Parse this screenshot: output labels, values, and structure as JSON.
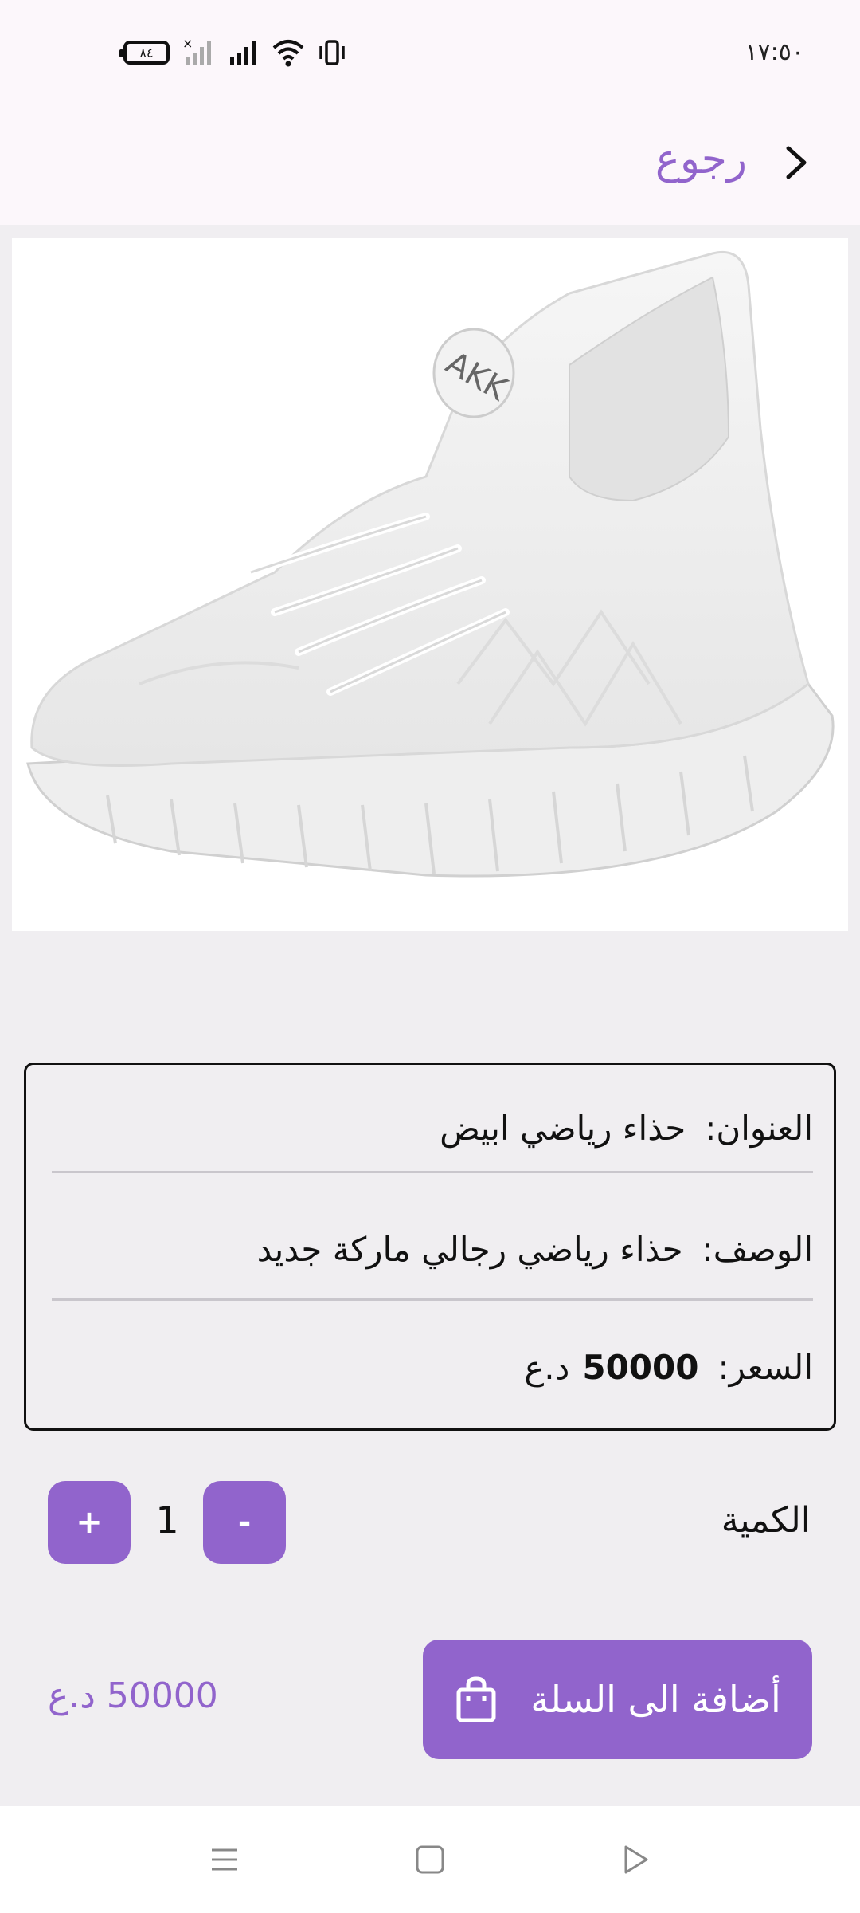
{
  "status_bar": {
    "time": "١٧:٥٠",
    "battery_level": "٨٤",
    "icons": [
      "battery-icon",
      "signal-off-icon",
      "signal-icon",
      "wifi-icon",
      "vibrate-icon"
    ]
  },
  "header": {
    "back_label": "رجوع"
  },
  "product": {
    "image": "white-sneaker-image",
    "title_label": "العنوان:",
    "title_value": "حذاء رياضي ابيض",
    "description_label": "الوصف:",
    "description_value": "حذاء رياضي رجالي ماركة جديد",
    "price_label": "السعر:",
    "price_value": "50000",
    "price_currency": "د.ع"
  },
  "quantity": {
    "label": "الكمية",
    "value": "1",
    "minus_label": "-",
    "plus_label": "+"
  },
  "cart": {
    "add_label": "أضافة الى السلة",
    "total": "50000 د.ع"
  },
  "colors": {
    "accent": "#9164cc",
    "background": "#f0eef1",
    "header_bg": "#fcf7fb"
  }
}
